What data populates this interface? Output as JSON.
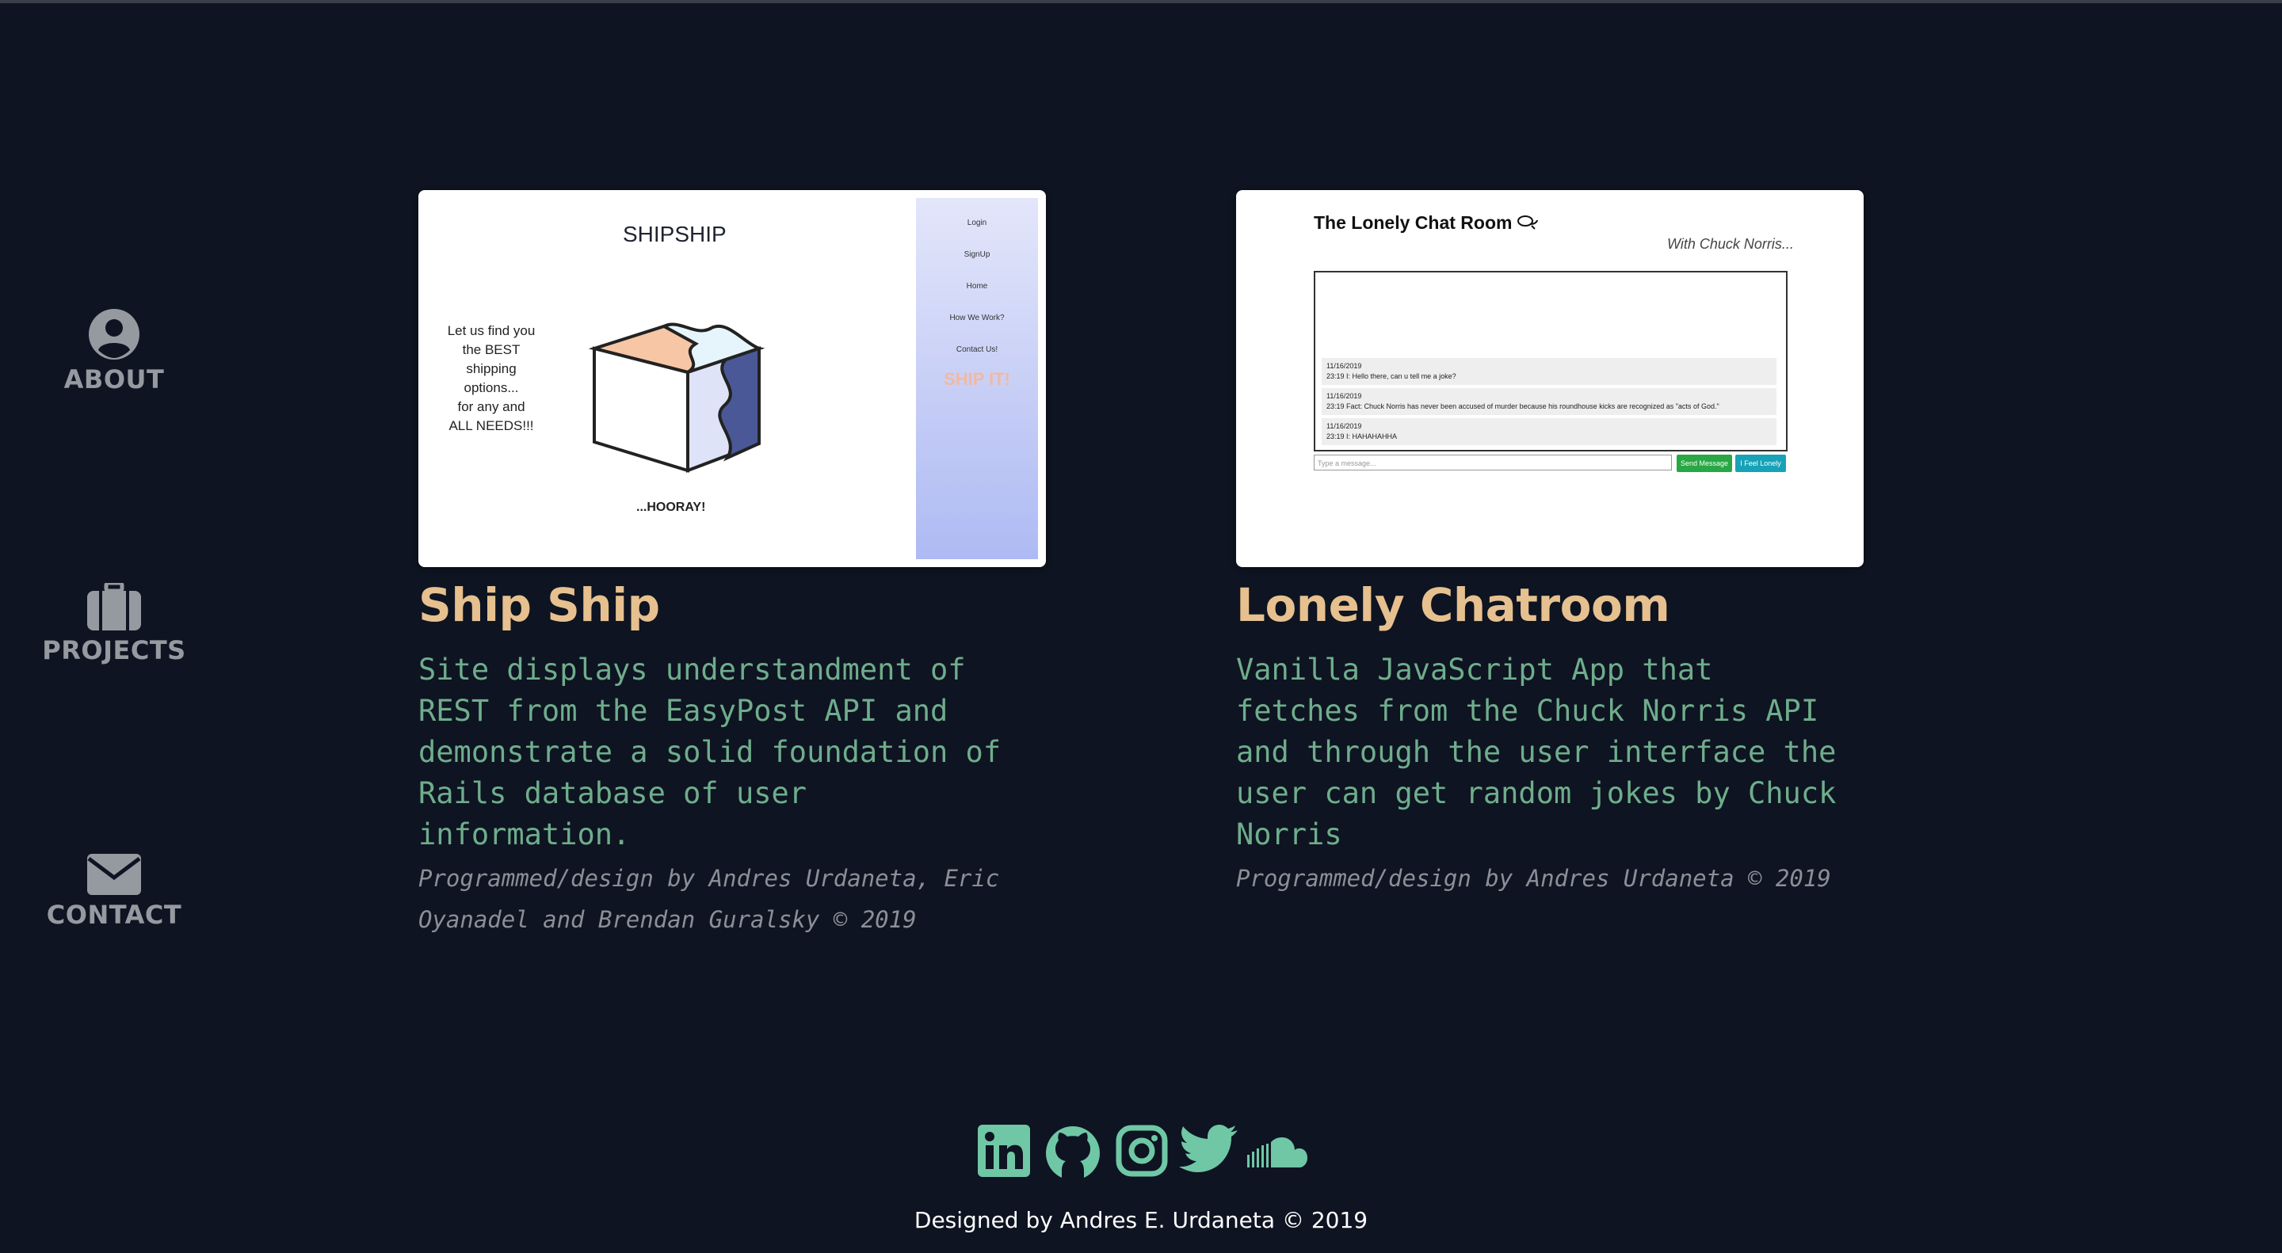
{
  "nav": {
    "about": "ABOUT",
    "projects": "PROJECTS",
    "contact": "CONTACT"
  },
  "projects": [
    {
      "title": "Ship Ship",
      "description": "Site displays understandment of REST from the EasyPost API and demonstrate a solid foundation of Rails database of user information.",
      "credit": "Programmed/design by Andres Urdaneta, Eric Oyanadel and Brendan Guralsky © 2019",
      "thumbnail": {
        "title": "SHIPSHIP",
        "left_text": [
          "Let us find you",
          "the BEST",
          "shipping",
          "options...",
          "for any and",
          "ALL NEEDS!!!"
        ],
        "bottom_text": "...HOORAY!",
        "menu": [
          "Login",
          "SignUp",
          "Home",
          "How We Work?",
          "Contact Us!"
        ],
        "cta": "SHIP IT!"
      }
    },
    {
      "title": "Lonely Chatroom",
      "description": "Vanilla JavaScript App that fetches from the Chuck Norris API and through the user interface the user can get random jokes by Chuck Norris",
      "credit": "Programmed/design by Andres Urdaneta © 2019",
      "thumbnail": {
        "title": "The Lonely Chat Room",
        "subtitle": "With Chuck Norris...",
        "messages": [
          {
            "date": "11/16/2019",
            "text": "23:19 I: Hello there, can u tell me a joke?"
          },
          {
            "date": "11/16/2019",
            "text": "23:19 Fact: Chuck Norris has never been accused of murder because his roundhouse kicks are recognized as \"acts of God.\""
          },
          {
            "date": "11/16/2019",
            "text": "23:19 I: HAHAHAHHA"
          }
        ],
        "input_placeholder": "Type a message...",
        "send_label": "Send Message",
        "lonely_label": "I Feel Lonely"
      }
    }
  ],
  "social_icons": [
    "linkedin-icon",
    "github-icon",
    "instagram-icon",
    "twitter-icon",
    "soundcloud-icon"
  ],
  "colors": {
    "background": "#0e1421",
    "title": "#e6c08f",
    "description": "#6fad8c",
    "social": "#6fc7a5",
    "nav": "#959aa1"
  },
  "footer": {
    "text": "Designed by Andres E. Urdaneta © 2019"
  }
}
